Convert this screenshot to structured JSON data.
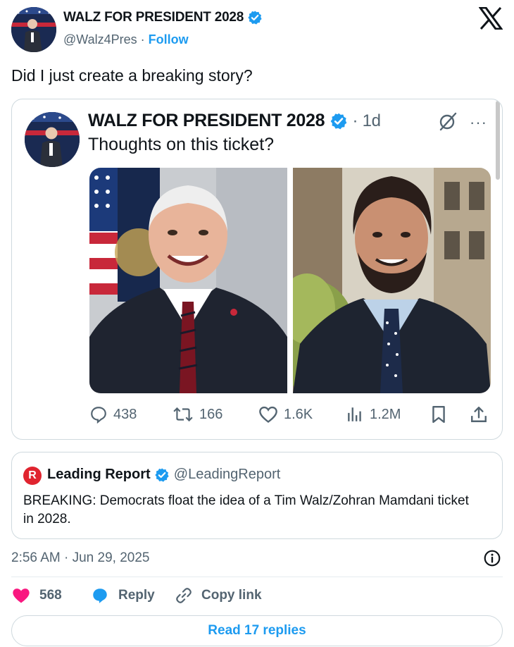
{
  "author": {
    "name": "WALZ FOR PRESIDENT 2028",
    "handle": "@Walz4Pres",
    "separator": "·",
    "follow_label": "Follow"
  },
  "tweet_text": "Did I just create a breaking story?",
  "quoted": {
    "name": "WALZ FOR PRESIDENT 2028",
    "time": "· 1d",
    "more": "···",
    "text": "Thoughts on this ticket?",
    "photos": [
      "walz-portrait",
      "mamdani-portrait"
    ],
    "metrics": {
      "replies": "438",
      "reposts": "166",
      "likes": "1.6K",
      "views": "1.2M"
    }
  },
  "leading_report": {
    "logo_letter": "R",
    "name": "Leading Report",
    "handle": "@LeadingReport",
    "text": "BREAKING: Democrats float the idea of a Tim Walz/Zohran Mamdani ticket in 2028."
  },
  "timestamp": "2:56 AM · Jun 29, 2025",
  "footer": {
    "likes": "568",
    "reply_label": "Reply",
    "copy_label": "Copy link",
    "read_replies_label": "Read 17 replies"
  },
  "colors": {
    "accent": "#1d9bf0",
    "like": "#f91880",
    "muted": "#536471",
    "border": "#cfd9de",
    "logo_red": "#e0242f"
  }
}
